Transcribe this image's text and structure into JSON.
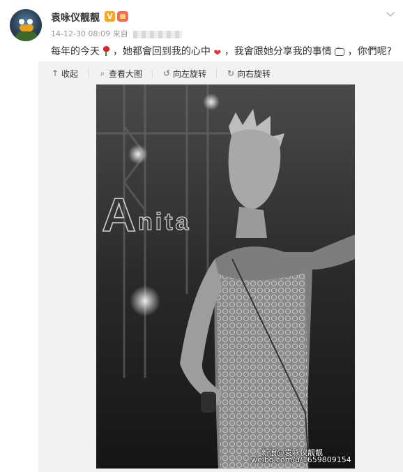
{
  "user": {
    "name": "袁咏仪靓靓",
    "verified_label": "V"
  },
  "meta": {
    "timestamp": "14-12-30 08:09",
    "source_prefix": "来自"
  },
  "post": {
    "text_1": "每年的今天",
    "text_2": "，她都會回到我的心中",
    "text_3": "，我會跟她分享我的事情",
    "text_4": "，你們呢?"
  },
  "toolbar": {
    "collapse_label": "收起",
    "view_large_label": "查看大图",
    "rotate_left_label": "向左旋转",
    "rotate_right_label": "向右旋转"
  },
  "image": {
    "overlay_text": "Anita"
  },
  "watermark": {
    "site": "新浪@袁咏仪靓靓",
    "url": "weibo.com/u/1659809154"
  },
  "icons": [
    "collapse-arrow-icon",
    "magnifier-icon",
    "rotate-left-icon",
    "rotate-right-icon",
    "chevron-down-icon",
    "verified-icon",
    "member-icon",
    "rose-emoji-icon",
    "heart-emoji-icon",
    "chat-bubble-emoji-icon"
  ],
  "colors": {
    "verified": "#f6a623",
    "heart": "#e0333f",
    "text": "#333333",
    "meta": "#999999"
  }
}
